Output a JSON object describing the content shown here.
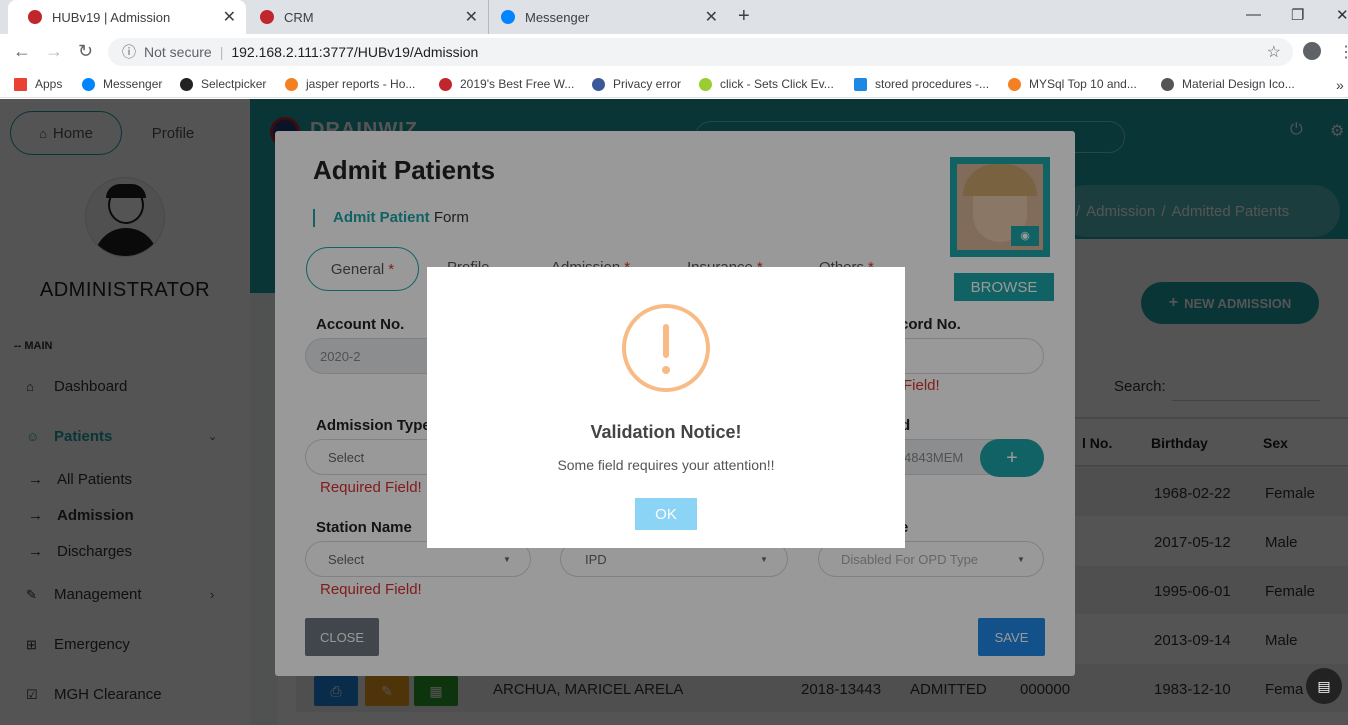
{
  "browser": {
    "tabs": [
      {
        "title": "HUBv19 | Admission",
        "active": true,
        "color": "#c0272d"
      },
      {
        "title": "CRM",
        "active": false,
        "color": "#c0272d"
      },
      {
        "title": "Messenger",
        "active": false,
        "color": "#0084ff"
      }
    ],
    "address": {
      "security": "Not secure",
      "url": "192.168.2.111:3777/HUBv19/Admission"
    },
    "bookmarks": [
      {
        "label": "Apps",
        "color": "#e94235"
      },
      {
        "label": "Messenger",
        "color": "#0084ff"
      },
      {
        "label": "Selectpicker",
        "color": "#222"
      },
      {
        "label": "jasper reports - Ho...",
        "color": "#f48024"
      },
      {
        "label": "2019's Best Free W...",
        "color": "#c0272d"
      },
      {
        "label": "Privacy error",
        "color": "#3b5998"
      },
      {
        "label": "click - Sets Click Ev...",
        "color": "#9acd32"
      },
      {
        "label": "stored procedures -...",
        "color": "#1e88e5"
      },
      {
        "label": "MYSql Top 10 and...",
        "color": "#f48024"
      },
      {
        "label": "Material Design Ico...",
        "color": "#555"
      }
    ]
  },
  "sidebar": {
    "home": "Home",
    "profile": "Profile",
    "username": "ADMINISTRATOR",
    "section": "-- MAIN",
    "items": {
      "dashboard": "Dashboard",
      "patients": "Patients",
      "all_patients": "All Patients",
      "admission": "Admission",
      "discharges": "Discharges",
      "management": "Management",
      "emergency": "Emergency",
      "mgh": "MGH Clearance"
    }
  },
  "header": {
    "brand": "DRAINWIZ",
    "breadcrumb_admission": "Admission",
    "breadcrumb_sep": "/",
    "breadcrumb_current": "Admitted Patients",
    "new_admission": "NEW ADMISSION",
    "search_label": "Search:"
  },
  "table": {
    "headers": [
      "l No.",
      "Birthday",
      "Sex"
    ],
    "rows": [
      {
        "birthday": "1968-02-22",
        "sex": "Female"
      },
      {
        "birthday": "2017-05-12",
        "sex": "Male"
      },
      {
        "birthday": "1995-06-01",
        "sex": "Female"
      },
      {
        "birthday": "2013-09-14",
        "sex": "Male"
      }
    ],
    "last_row": {
      "name": "ARCHUA, MARICEL ARELA",
      "account": "2018-13443",
      "status": "ADMITTED",
      "code": "000000",
      "birthday": "1983-12-10",
      "sex": "Fema"
    }
  },
  "modal": {
    "title": "Admit Patients",
    "subtitle_bold": "Admit Patient",
    "subtitle_rest": " Form",
    "tabs": [
      {
        "label": "General",
        "req": "*"
      },
      {
        "label": "Profile",
        "req": ""
      },
      {
        "label": "Admission",
        "req": "*"
      },
      {
        "label": "Insurance",
        "req": "*"
      },
      {
        "label": "Others",
        "req": "*"
      }
    ],
    "browse": "BROWSE",
    "fields": {
      "account_label": "Account No.",
      "account_value": "2020-2",
      "record_label": "cord No.",
      "record_req": "Field!",
      "admission_type_label": "Admission Type",
      "admission_type_value": "Select",
      "admission_type_req": "Required Field!",
      "id_label": "d",
      "id_value": "4843MEM",
      "station_label": "Station Name",
      "station_value": "Select",
      "station_req": "Required Field!",
      "type_value": "IPD",
      "room_label": "e",
      "room_value": "Disabled For OPD Type"
    },
    "close": "CLOSE",
    "save": "SAVE"
  },
  "alert": {
    "title": "Validation Notice!",
    "message": "Some field requires your attention!!",
    "ok": "OK",
    "icon_color": "#f8bb86"
  }
}
